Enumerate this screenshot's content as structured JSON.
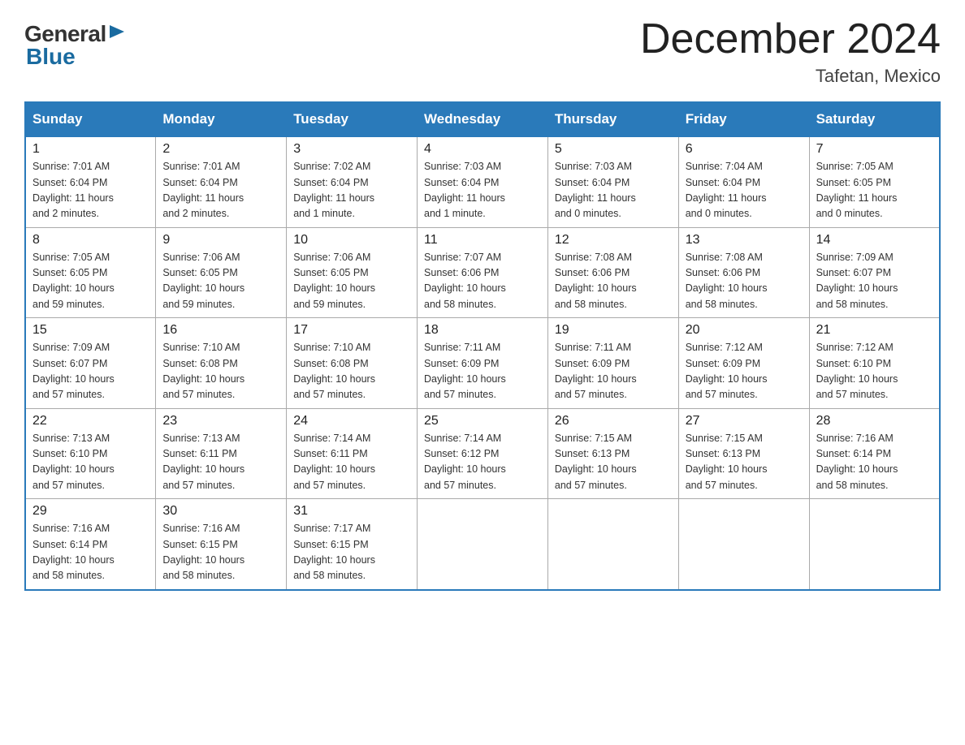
{
  "header": {
    "logo_general": "General",
    "logo_blue": "Blue",
    "title": "December 2024",
    "location": "Tafetan, Mexico"
  },
  "weekdays": [
    "Sunday",
    "Monday",
    "Tuesday",
    "Wednesday",
    "Thursday",
    "Friday",
    "Saturday"
  ],
  "weeks": [
    [
      {
        "day": "1",
        "sunrise": "7:01 AM",
        "sunset": "6:04 PM",
        "daylight": "11 hours and 2 minutes."
      },
      {
        "day": "2",
        "sunrise": "7:01 AM",
        "sunset": "6:04 PM",
        "daylight": "11 hours and 2 minutes."
      },
      {
        "day": "3",
        "sunrise": "7:02 AM",
        "sunset": "6:04 PM",
        "daylight": "11 hours and 1 minute."
      },
      {
        "day": "4",
        "sunrise": "7:03 AM",
        "sunset": "6:04 PM",
        "daylight": "11 hours and 1 minute."
      },
      {
        "day": "5",
        "sunrise": "7:03 AM",
        "sunset": "6:04 PM",
        "daylight": "11 hours and 0 minutes."
      },
      {
        "day": "6",
        "sunrise": "7:04 AM",
        "sunset": "6:04 PM",
        "daylight": "11 hours and 0 minutes."
      },
      {
        "day": "7",
        "sunrise": "7:05 AM",
        "sunset": "6:05 PM",
        "daylight": "11 hours and 0 minutes."
      }
    ],
    [
      {
        "day": "8",
        "sunrise": "7:05 AM",
        "sunset": "6:05 PM",
        "daylight": "10 hours and 59 minutes."
      },
      {
        "day": "9",
        "sunrise": "7:06 AM",
        "sunset": "6:05 PM",
        "daylight": "10 hours and 59 minutes."
      },
      {
        "day": "10",
        "sunrise": "7:06 AM",
        "sunset": "6:05 PM",
        "daylight": "10 hours and 59 minutes."
      },
      {
        "day": "11",
        "sunrise": "7:07 AM",
        "sunset": "6:06 PM",
        "daylight": "10 hours and 58 minutes."
      },
      {
        "day": "12",
        "sunrise": "7:08 AM",
        "sunset": "6:06 PM",
        "daylight": "10 hours and 58 minutes."
      },
      {
        "day": "13",
        "sunrise": "7:08 AM",
        "sunset": "6:06 PM",
        "daylight": "10 hours and 58 minutes."
      },
      {
        "day": "14",
        "sunrise": "7:09 AM",
        "sunset": "6:07 PM",
        "daylight": "10 hours and 58 minutes."
      }
    ],
    [
      {
        "day": "15",
        "sunrise": "7:09 AM",
        "sunset": "6:07 PM",
        "daylight": "10 hours and 57 minutes."
      },
      {
        "day": "16",
        "sunrise": "7:10 AM",
        "sunset": "6:08 PM",
        "daylight": "10 hours and 57 minutes."
      },
      {
        "day": "17",
        "sunrise": "7:10 AM",
        "sunset": "6:08 PM",
        "daylight": "10 hours and 57 minutes."
      },
      {
        "day": "18",
        "sunrise": "7:11 AM",
        "sunset": "6:09 PM",
        "daylight": "10 hours and 57 minutes."
      },
      {
        "day": "19",
        "sunrise": "7:11 AM",
        "sunset": "6:09 PM",
        "daylight": "10 hours and 57 minutes."
      },
      {
        "day": "20",
        "sunrise": "7:12 AM",
        "sunset": "6:09 PM",
        "daylight": "10 hours and 57 minutes."
      },
      {
        "day": "21",
        "sunrise": "7:12 AM",
        "sunset": "6:10 PM",
        "daylight": "10 hours and 57 minutes."
      }
    ],
    [
      {
        "day": "22",
        "sunrise": "7:13 AM",
        "sunset": "6:10 PM",
        "daylight": "10 hours and 57 minutes."
      },
      {
        "day": "23",
        "sunrise": "7:13 AM",
        "sunset": "6:11 PM",
        "daylight": "10 hours and 57 minutes."
      },
      {
        "day": "24",
        "sunrise": "7:14 AM",
        "sunset": "6:11 PM",
        "daylight": "10 hours and 57 minutes."
      },
      {
        "day": "25",
        "sunrise": "7:14 AM",
        "sunset": "6:12 PM",
        "daylight": "10 hours and 57 minutes."
      },
      {
        "day": "26",
        "sunrise": "7:15 AM",
        "sunset": "6:13 PM",
        "daylight": "10 hours and 57 minutes."
      },
      {
        "day": "27",
        "sunrise": "7:15 AM",
        "sunset": "6:13 PM",
        "daylight": "10 hours and 57 minutes."
      },
      {
        "day": "28",
        "sunrise": "7:16 AM",
        "sunset": "6:14 PM",
        "daylight": "10 hours and 58 minutes."
      }
    ],
    [
      {
        "day": "29",
        "sunrise": "7:16 AM",
        "sunset": "6:14 PM",
        "daylight": "10 hours and 58 minutes."
      },
      {
        "day": "30",
        "sunrise": "7:16 AM",
        "sunset": "6:15 PM",
        "daylight": "10 hours and 58 minutes."
      },
      {
        "day": "31",
        "sunrise": "7:17 AM",
        "sunset": "6:15 PM",
        "daylight": "10 hours and 58 minutes."
      },
      null,
      null,
      null,
      null
    ]
  ],
  "labels": {
    "sunrise": "Sunrise:",
    "sunset": "Sunset:",
    "daylight": "Daylight:"
  }
}
